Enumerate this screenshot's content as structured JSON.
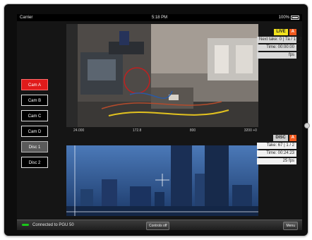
{
  "statusbar": {
    "carrier": "Carrier",
    "time": "5:18 PM",
    "battery": "100%"
  },
  "cameras": [
    {
      "label": "Cam A",
      "state": "active"
    },
    {
      "label": "Cam B",
      "state": "normal"
    },
    {
      "label": "Cam C",
      "state": "normal"
    },
    {
      "label": "Cam D",
      "state": "normal"
    },
    {
      "label": "Disc 1",
      "state": "gray"
    },
    {
      "label": "Disc 2",
      "state": "normal"
    }
  ],
  "live": {
    "badge": "LIVE",
    "cam": "A",
    "next_take": "Next take: 0 | 7a / 1 / 2",
    "time": "Time: 00:00:00",
    "fps": "fps"
  },
  "metrics": [
    "24.000",
    "172.8",
    "800",
    "3200 +0"
  ],
  "disc": {
    "badge": "DISC",
    "cam": "A",
    "take": "Take: 67 | 1 / 2",
    "time": "Time: 00:24:23",
    "fps": "25 fps"
  },
  "bottombar": {
    "connection": "Connected to PGU 50",
    "controls_label": "Controls off",
    "menu_label": "Menu"
  },
  "colors": {
    "accent_red": "#e01b1b",
    "live_yellow": "#f2e21c",
    "cam_orange": "#f05a1f",
    "connected_green": "#19c719"
  }
}
